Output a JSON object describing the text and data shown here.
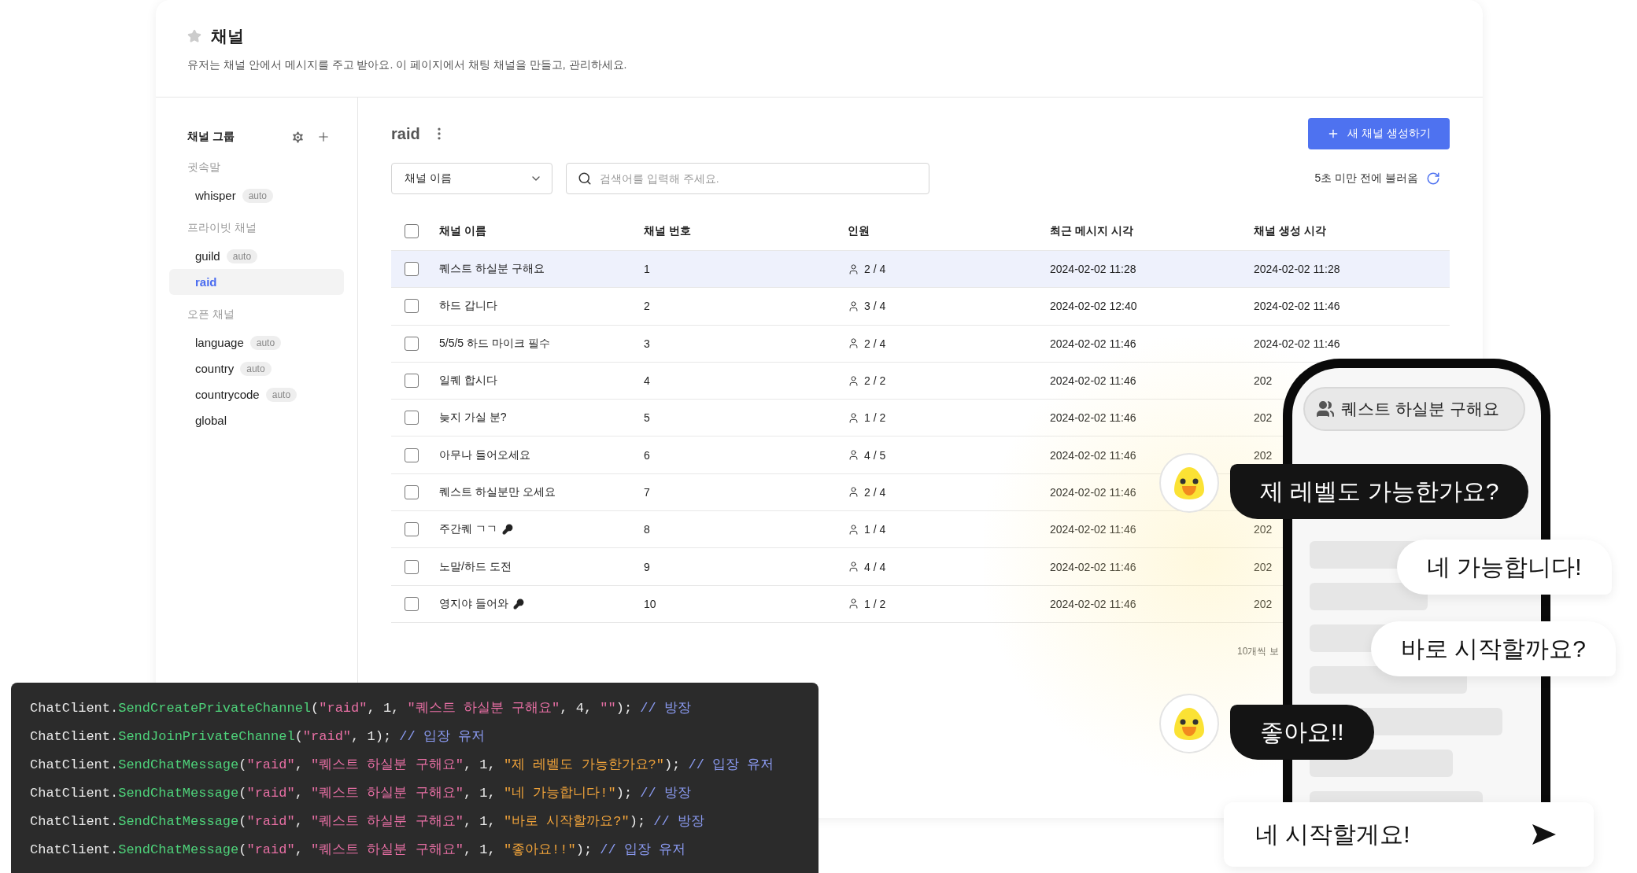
{
  "header": {
    "title": "채널",
    "description": "유저는 채널 안에서 메시지를 주고 받아요. 이 페이지에서 채팅 채널을 만들고, 관리하세요."
  },
  "sidebar": {
    "title": "채널 그룹",
    "sections": [
      {
        "label": "귓속말",
        "items": [
          {
            "label": "whisper",
            "badge": "auto",
            "selected": false
          }
        ]
      },
      {
        "label": "프라이빗 채널",
        "items": [
          {
            "label": "guild",
            "badge": "auto",
            "selected": false
          },
          {
            "label": "raid",
            "selected": true
          }
        ]
      },
      {
        "label": "오픈 채널",
        "items": [
          {
            "label": "language",
            "badge": "auto",
            "selected": false
          },
          {
            "label": "country",
            "badge": "auto",
            "selected": false
          },
          {
            "label": "countrycode",
            "badge": "auto",
            "selected": false
          },
          {
            "label": "global",
            "selected": false
          }
        ]
      }
    ]
  },
  "main": {
    "title": "raid",
    "create_button": "새 채널 생성하기",
    "filter": {
      "value": "채널 이름"
    },
    "search": {
      "placeholder": "검색어를 입력해 주세요."
    },
    "refreshed": "5초 미만 전에 불러옴",
    "footer": "10개씩 보"
  },
  "table": {
    "select_all": {
      "checked": false
    },
    "columns": [
      "채널 이름",
      "채널 번호",
      "인원",
      "최근 메시지 시각",
      "채널 생성 시각"
    ],
    "rows": [
      {
        "name": "퀘스트 하실분 구해요",
        "has_key": false,
        "number": "1",
        "members": "2 / 4",
        "recent": "2024-02-02 11:28",
        "created": "2024-02-02 11:28",
        "selected": true,
        "checked": false
      },
      {
        "name": "하드 갑니다",
        "has_key": false,
        "number": "2",
        "members": "3 / 4",
        "recent": "2024-02-02 12:40",
        "created": "2024-02-02 11:46",
        "selected": false,
        "checked": false
      },
      {
        "name": "5/5/5 하드 마이크 필수",
        "has_key": false,
        "number": "3",
        "members": "2 / 4",
        "recent": "2024-02-02 11:46",
        "created": "2024-02-02 11:46",
        "selected": false,
        "checked": false
      },
      {
        "name": "일퀘 합시다",
        "has_key": false,
        "number": "4",
        "members": "2 / 2",
        "recent": "2024-02-02 11:46",
        "created": "202",
        "selected": false,
        "checked": false
      },
      {
        "name": "늦지 가실 분?",
        "has_key": false,
        "number": "5",
        "members": "1 / 2",
        "recent": "2024-02-02 11:46",
        "created": "202",
        "selected": false,
        "checked": false
      },
      {
        "name": "아무나 들어오세요",
        "has_key": false,
        "number": "6",
        "members": "4 / 5",
        "recent": "2024-02-02 11:46",
        "created": "202",
        "selected": false,
        "checked": false
      },
      {
        "name": "퀘스트 하실분만 오세요",
        "has_key": false,
        "number": "7",
        "members": "2 / 4",
        "recent": "2024-02-02 11:46",
        "selected": false,
        "checked": false
      },
      {
        "name": "주간퀘 ㄱㄱ",
        "has_key": true,
        "number": "8",
        "members": "1 / 4",
        "recent": "2024-02-02 11:46",
        "created": "202",
        "selected": false,
        "checked": false
      },
      {
        "name": "노말/하드 도전",
        "has_key": false,
        "number": "9",
        "members": "4 / 4",
        "recent": "2024-02-02 11:46",
        "created": "202",
        "selected": false,
        "checked": false
      },
      {
        "name": "영지야 들어와",
        "has_key": true,
        "number": "10",
        "members": "1 / 2",
        "recent": "2024-02-02 11:46",
        "created": "202",
        "selected": false,
        "checked": false
      }
    ]
  },
  "code": {
    "lines": [
      [
        {
          "kind": "plain",
          "text": "ChatClient."
        },
        {
          "kind": "method",
          "text": "SendCreatePrivateChannel"
        },
        {
          "kind": "plain",
          "text": "("
        },
        {
          "kind": "string",
          "text": "\"raid\""
        },
        {
          "kind": "plain",
          "text": ", 1, "
        },
        {
          "kind": "string",
          "text": "\"퀘스트 하실분 구해요\""
        },
        {
          "kind": "plain",
          "text": ", 4, "
        },
        {
          "kind": "string",
          "text": "\"\""
        },
        {
          "kind": "plain",
          "text": "); "
        },
        {
          "kind": "comment",
          "text": "// 방장"
        }
      ],
      [
        {
          "kind": "plain",
          "text": "ChatClient."
        },
        {
          "kind": "method",
          "text": "SendJoinPrivateChannel"
        },
        {
          "kind": "plain",
          "text": "("
        },
        {
          "kind": "string",
          "text": "\"raid\""
        },
        {
          "kind": "plain",
          "text": ", 1); "
        },
        {
          "kind": "comment",
          "text": "// 입장 유저"
        }
      ],
      [
        {
          "kind": "plain",
          "text": "ChatClient."
        },
        {
          "kind": "method",
          "text": "SendChatMessage"
        },
        {
          "kind": "plain",
          "text": "("
        },
        {
          "kind": "string",
          "text": "\"raid\""
        },
        {
          "kind": "plain",
          "text": ", "
        },
        {
          "kind": "string",
          "text": "\"퀘스트 하실분 구해요\""
        },
        {
          "kind": "plain",
          "text": ", 1, "
        },
        {
          "kind": "message",
          "text": "\"제 레벨도 가능한가요?\""
        },
        {
          "kind": "plain",
          "text": "); "
        },
        {
          "kind": "comment",
          "text": "// 입장 유저"
        }
      ],
      [
        {
          "kind": "plain",
          "text": "ChatClient."
        },
        {
          "kind": "method",
          "text": "SendChatMessage"
        },
        {
          "kind": "plain",
          "text": "("
        },
        {
          "kind": "string",
          "text": "\"raid\""
        },
        {
          "kind": "plain",
          "text": ", "
        },
        {
          "kind": "string",
          "text": "\"퀘스트 하실분 구해요\""
        },
        {
          "kind": "plain",
          "text": ", 1, "
        },
        {
          "kind": "message",
          "text": "\"네 가능합니다!\""
        },
        {
          "kind": "plain",
          "text": "); "
        },
        {
          "kind": "comment",
          "text": "// 방장"
        }
      ],
      [
        {
          "kind": "plain",
          "text": "ChatClient."
        },
        {
          "kind": "method",
          "text": "SendChatMessage"
        },
        {
          "kind": "plain",
          "text": "("
        },
        {
          "kind": "string",
          "text": "\"raid\""
        },
        {
          "kind": "plain",
          "text": ", "
        },
        {
          "kind": "string",
          "text": "\"퀘스트 하실분 구해요\""
        },
        {
          "kind": "plain",
          "text": ", 1, "
        },
        {
          "kind": "message",
          "text": "\"바로 시작할까요?\""
        },
        {
          "kind": "plain",
          "text": "); "
        },
        {
          "kind": "comment",
          "text": "// 방장"
        }
      ],
      [
        {
          "kind": "plain",
          "text": "ChatClient."
        },
        {
          "kind": "method",
          "text": "SendChatMessage"
        },
        {
          "kind": "plain",
          "text": "("
        },
        {
          "kind": "string",
          "text": "\"raid\""
        },
        {
          "kind": "plain",
          "text": ", "
        },
        {
          "kind": "string",
          "text": "\"퀘스트 하실분 구해요\""
        },
        {
          "kind": "plain",
          "text": ", 1, "
        },
        {
          "kind": "message",
          "text": "\"좋아요!!\""
        },
        {
          "kind": "plain",
          "text": "); "
        },
        {
          "kind": "comment",
          "text": "// 입장 유저"
        }
      ]
    ]
  },
  "chat": {
    "channel": "퀘스트 하실분 구해요",
    "messages": [
      {
        "kind": "incoming",
        "text": "제 레벨도 가능한가요?"
      },
      {
        "kind": "outgoing",
        "text": "네 가능합니다!"
      },
      {
        "kind": "outgoing",
        "text": "바로 시작할까요?"
      },
      {
        "kind": "incoming",
        "text": "좋아요!!"
      }
    ],
    "input": {
      "value": "네 시작할게요!"
    }
  }
}
